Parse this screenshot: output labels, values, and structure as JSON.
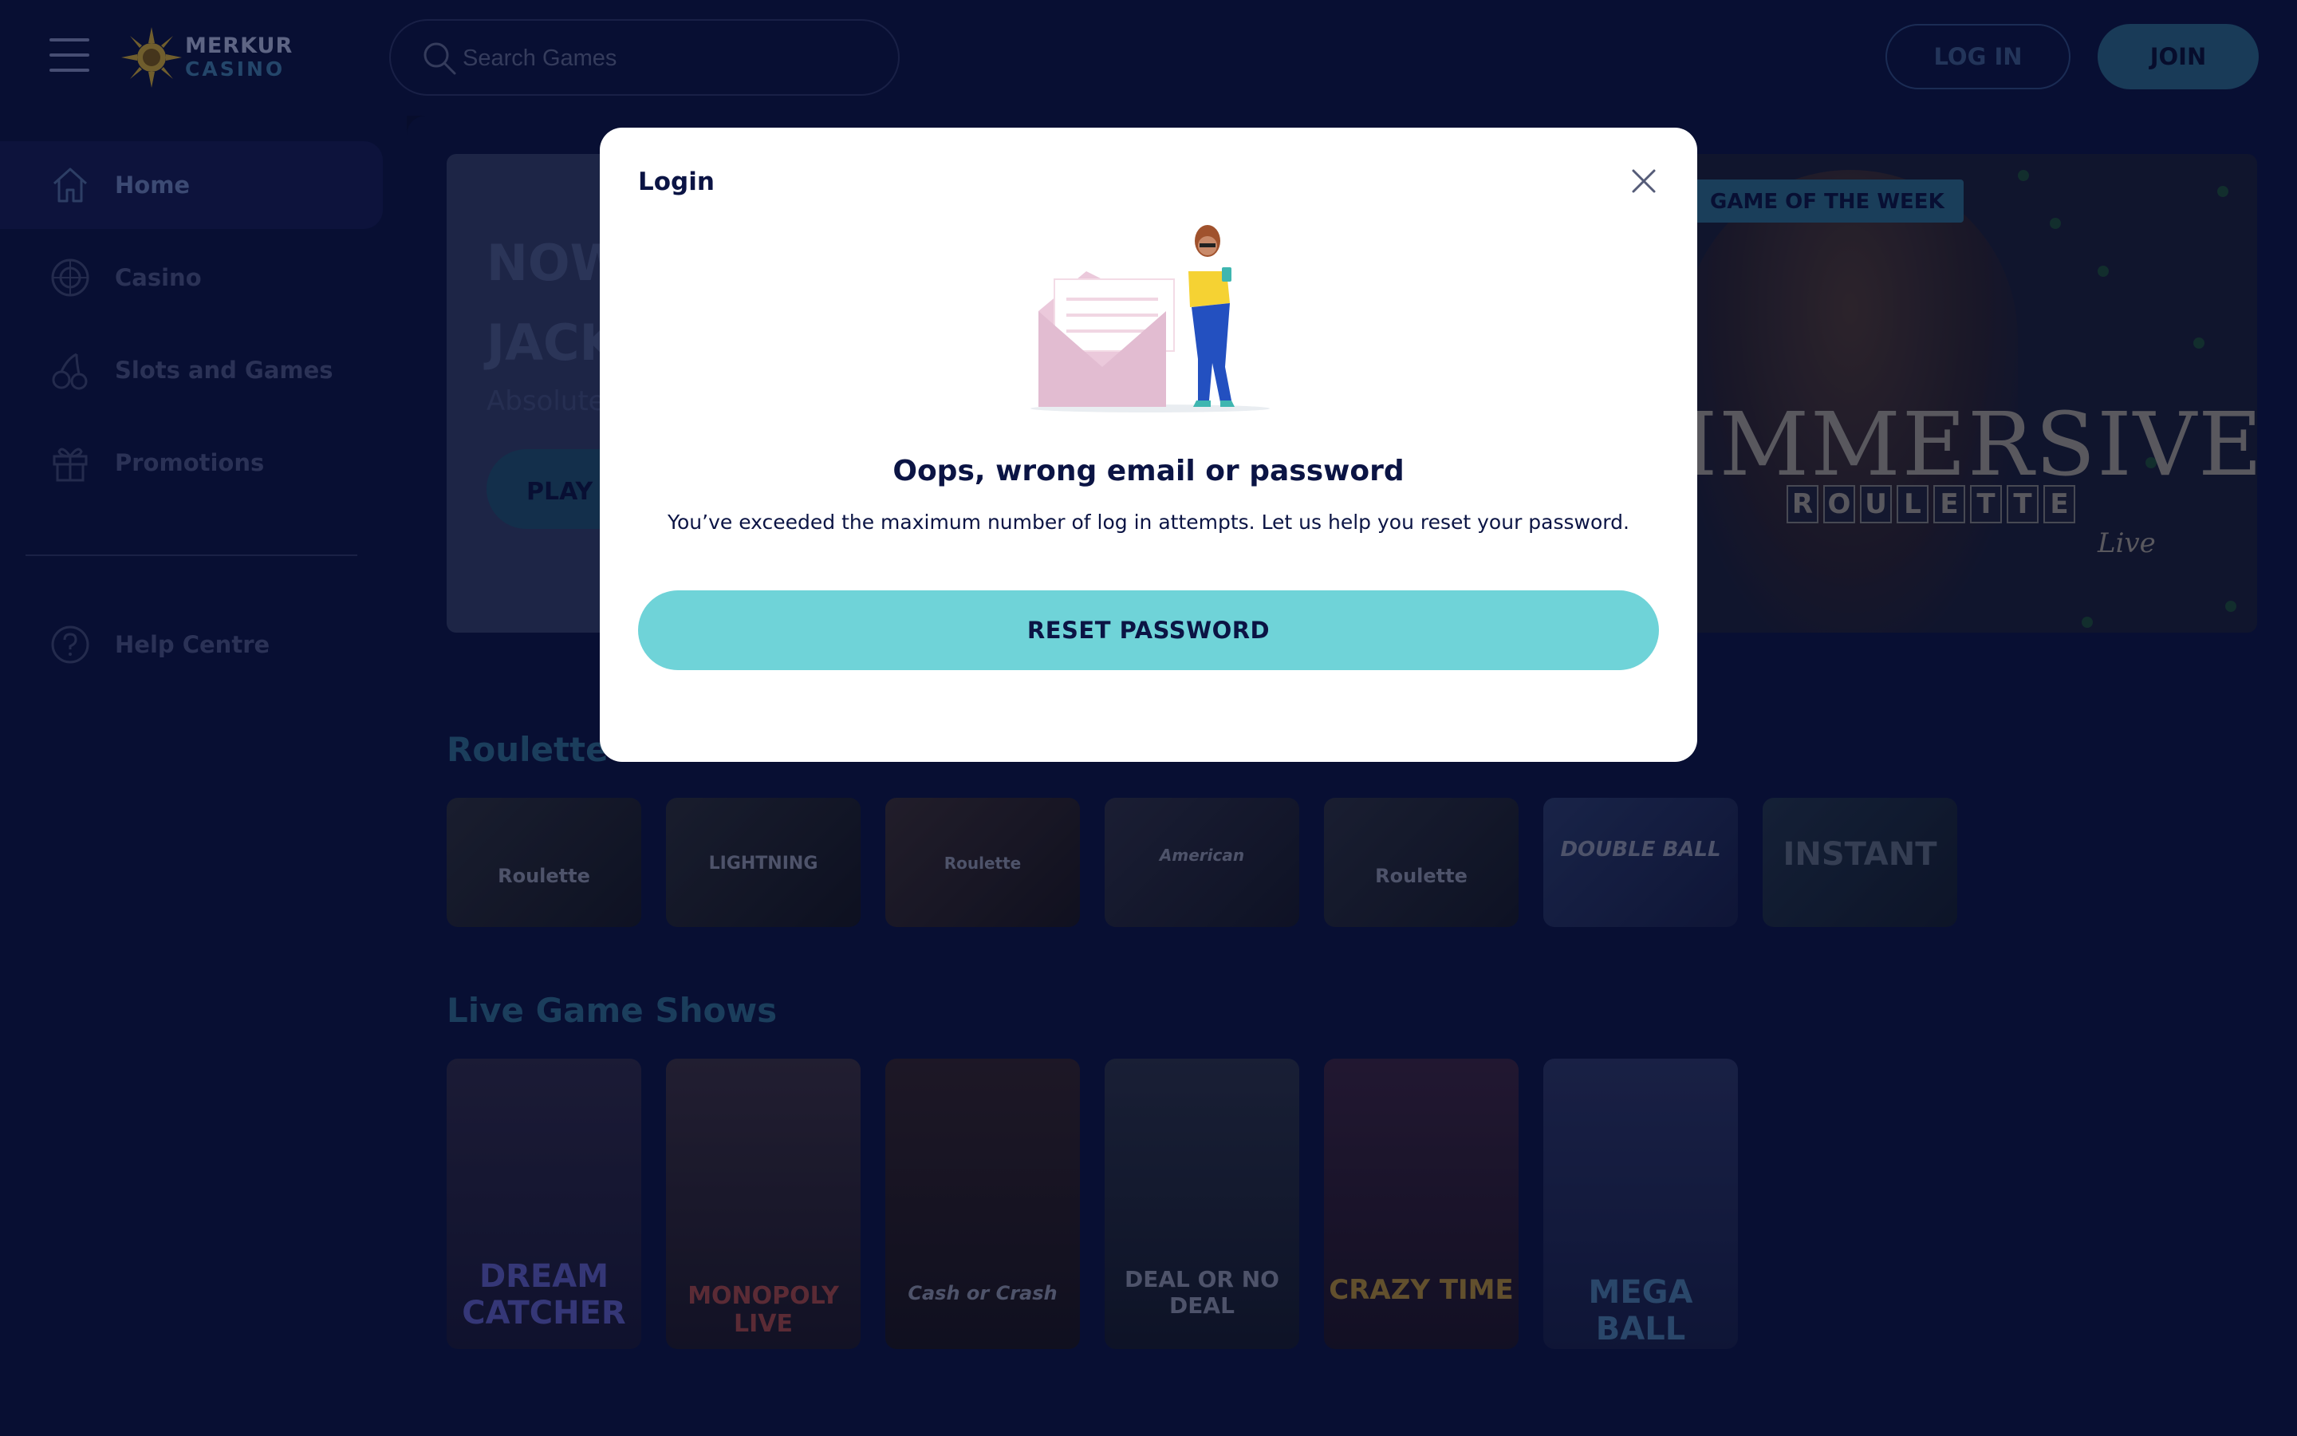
{
  "header": {
    "logo_line1": "MERKUR",
    "logo_line2": "CASINO",
    "search_placeholder": "Search Games",
    "login_label": "LOG IN",
    "join_label": "JOIN"
  },
  "sidebar": {
    "items": [
      {
        "label": "Home",
        "icon": "home-icon",
        "active": true
      },
      {
        "label": "Casino",
        "icon": "roulette-wheel-icon",
        "active": false
      },
      {
        "label": "Slots and Games",
        "icon": "cherries-icon",
        "active": false
      },
      {
        "label": "Promotions",
        "icon": "gift-icon",
        "active": false
      }
    ],
    "help_label": "Help Centre"
  },
  "banner_left": {
    "line1": "NOW",
    "line2": "JACK",
    "line3": "Absolute",
    "play_label": "PLAY N"
  },
  "banner_right": {
    "badge": "GAME OF THE WEEK",
    "title": "IMMERSIVE",
    "subtitle_letters": [
      "R",
      "O",
      "U",
      "L",
      "E",
      "T",
      "T",
      "E"
    ],
    "subtitle_tag": "Live"
  },
  "sections": {
    "roulette": {
      "title": "Roulette",
      "games": [
        "Roulette",
        "LIGHTNING",
        "Roulette",
        "American",
        "Roulette",
        "DOUBLE BALL",
        "INSTANT"
      ]
    },
    "live_shows": {
      "title": "Live Game Shows",
      "games": [
        "DREAM CATCHER",
        "MONOPOLY LIVE",
        "Cash or Crash",
        "DEAL OR NO DEAL",
        "CRAZY TIME",
        "MEGA BALL"
      ]
    }
  },
  "modal": {
    "title": "Login",
    "heading": "Oops, wrong email or password",
    "body": "You’ve exceeded the maximum number of log in attempts. Let us help you reset your password.",
    "button_label": "RESET PASSWORD"
  },
  "colors": {
    "background": "#0a1238",
    "accent": "#6fd3d8",
    "join_button": "#2b6487"
  }
}
